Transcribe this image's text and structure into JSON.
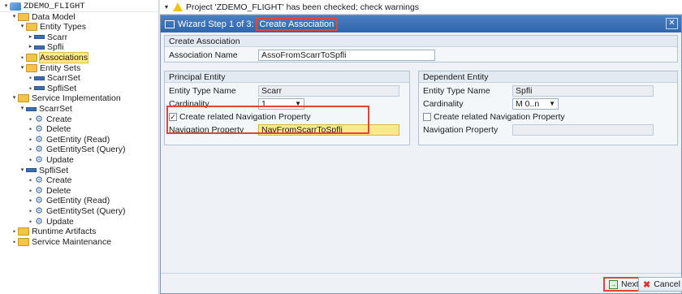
{
  "tree": {
    "items": [
      {
        "label": "ZDEMO_FLIGHT",
        "kind": "project",
        "level": 0,
        "toggle": "▾"
      },
      {
        "label": "Data Model",
        "kind": "folder",
        "level": 1,
        "toggle": "▾"
      },
      {
        "label": "Entity Types",
        "kind": "folder",
        "level": 2,
        "toggle": "▾"
      },
      {
        "label": "Scarr",
        "kind": "entity",
        "level": 3,
        "toggle": "▸"
      },
      {
        "label": "Spfli",
        "kind": "entity",
        "level": 3,
        "toggle": "▸"
      },
      {
        "label": "Associations",
        "kind": "folder",
        "level": 2,
        "toggle": "•",
        "selected": true
      },
      {
        "label": "Entity Sets",
        "kind": "folder",
        "level": 2,
        "toggle": "▾"
      },
      {
        "label": "ScarrSet",
        "kind": "entity",
        "level": 3,
        "toggle": "•"
      },
      {
        "label": "SpfliSet",
        "kind": "entity",
        "level": 3,
        "toggle": "•"
      },
      {
        "label": "Service Implementation",
        "kind": "folder",
        "level": 1,
        "toggle": "▾"
      },
      {
        "label": "ScarrSet",
        "kind": "entity",
        "level": 2,
        "toggle": "▾"
      },
      {
        "label": "Create",
        "kind": "op",
        "level": 3,
        "toggle": "•"
      },
      {
        "label": "Delete",
        "kind": "op",
        "level": 3,
        "toggle": "•"
      },
      {
        "label": "GetEntity (Read)",
        "kind": "op",
        "level": 3,
        "toggle": "•"
      },
      {
        "label": "GetEntitySet (Query)",
        "kind": "op",
        "level": 3,
        "toggle": "•"
      },
      {
        "label": "Update",
        "kind": "op",
        "level": 3,
        "toggle": "•"
      },
      {
        "label": "SpfliSet",
        "kind": "entity",
        "level": 2,
        "toggle": "▾"
      },
      {
        "label": "Create",
        "kind": "op",
        "level": 3,
        "toggle": "•"
      },
      {
        "label": "Delete",
        "kind": "op",
        "level": 3,
        "toggle": "•"
      },
      {
        "label": "GetEntity (Read)",
        "kind": "op",
        "level": 3,
        "toggle": "•"
      },
      {
        "label": "GetEntitySet (Query)",
        "kind": "op",
        "level": 3,
        "toggle": "•"
      },
      {
        "label": "Update",
        "kind": "op",
        "level": 3,
        "toggle": "•"
      },
      {
        "label": "Runtime Artifacts",
        "kind": "folder",
        "level": 1,
        "toggle": "•"
      },
      {
        "label": "Service Maintenance",
        "kind": "folder",
        "level": 1,
        "toggle": "•"
      }
    ]
  },
  "message": {
    "text": "Project 'ZDEMO_FLIGHT' has been checked; check warnings",
    "icon": "warning-icon"
  },
  "dialog": {
    "title_prefix": "Wizard Step 1 of 3:",
    "title_highlight": "Create Association",
    "create_association": {
      "header": "Create Association",
      "name_label": "Association Name",
      "name_value": "AssoFromScarrToSpfli"
    },
    "principal": {
      "header": "Principal Entity",
      "type_label": "Entity Type Name",
      "type_value": "Scarr",
      "card_label": "Cardinality",
      "card_value": "1",
      "nav_check_label": "Create related Navigation Property",
      "nav_checked": true,
      "nav_label": "Navigation Property",
      "nav_value": "NavFromScarrToSpfli"
    },
    "dependent": {
      "header": "Dependent Entity",
      "type_label": "Entity Type Name",
      "type_value": "Spfli",
      "card_label": "Cardinality",
      "card_value": "M 0..n",
      "nav_check_label": "Create related Navigation Property",
      "nav_checked": false,
      "nav_label": "Navigation Property",
      "nav_value": ""
    },
    "buttons": {
      "next": "Next",
      "cancel": "Cancel"
    }
  },
  "colors": {
    "highlight_red": "#e2453c",
    "title_bar": "#2f67ad",
    "focus_field": "#ffe98a"
  }
}
